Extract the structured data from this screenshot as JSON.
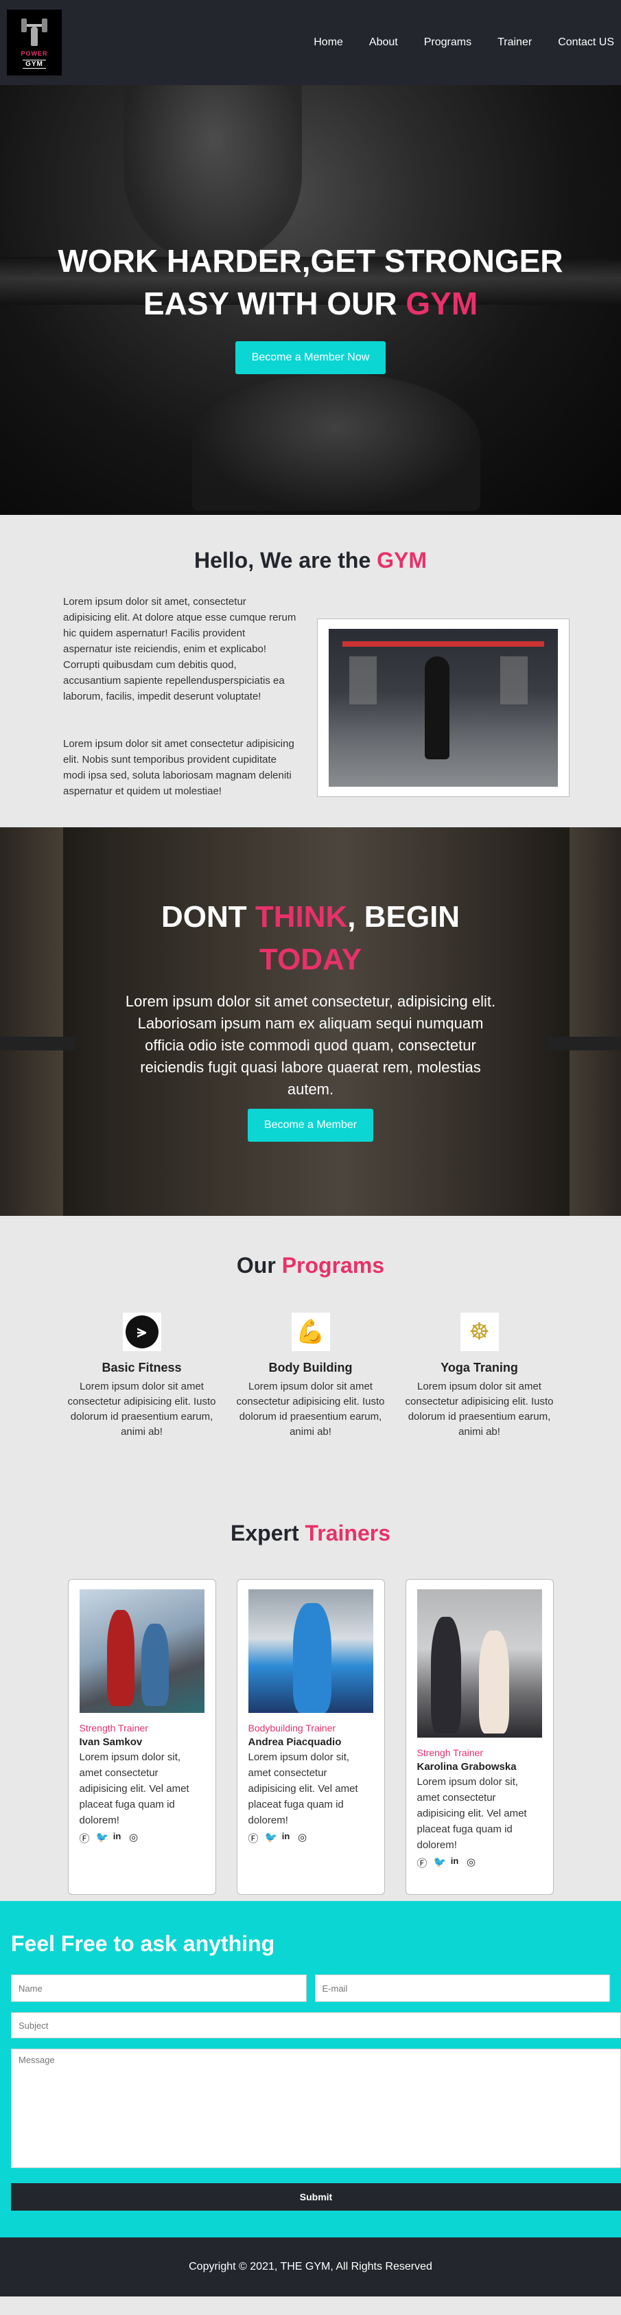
{
  "brand": {
    "logo_line1": "POWER",
    "logo_line2": "GYM"
  },
  "nav": {
    "items": [
      "Home",
      "About",
      "Programs",
      "Trainer",
      "Contact US"
    ]
  },
  "hero": {
    "line1": "WORK HARDER,GET STRONGER",
    "line2_prefix": "EASY WITH OUR ",
    "line2_accent": "GYM",
    "button": "Become a Member Now"
  },
  "about": {
    "title_prefix": "Hello, We are the ",
    "title_accent": "GYM",
    "para1": "Lorem ipsum dolor sit amet, consectetur adipisicing elit. At dolore atque esse cumque rerum hic quidem aspernatur! Facilis provident aspernatur iste reiciendis, enim et explicabo! Corrupti quibusdam cum debitis quod, accusantium sapiente repellendusperspiciatis ea laborum, facilis, impedit deserunt voluptate!",
    "para2": "Lorem ipsum dolor sit amet consectetur adipisicing elit. Nobis sunt temporibus provident cupiditate modi ipsa sed, soluta laboriosam magnam deleniti aspernatur et quidem ut molestiae!"
  },
  "cta": {
    "title_a": "DONT ",
    "title_accent": "THINK",
    "title_b": ", BEGIN",
    "title_accent2": "TODAY",
    "text": "Lorem ipsum dolor sit amet consectetur, adipisicing elit. Laboriosam ipsum nam ex aliquam sequi numquam officia odio iste commodi quod quam, consectetur reiciendis fugit quasi labore quaerat rem, molestias autem.",
    "button": "Become a Member"
  },
  "programs": {
    "title_prefix": "Our ",
    "title_accent": "Programs",
    "items": [
      {
        "name": "Basic Fitness",
        "icon": "dumbbell-icon",
        "desc": "Lorem ipsum dolor sit amet consectetur adipisicing elit. Iusto dolorum id praesentium earum, animi ab!"
      },
      {
        "name": "Body Building",
        "icon": "bodybuilder-icon",
        "desc": "Lorem ipsum dolor sit amet consectetur adipisicing elit. Iusto dolorum id praesentium earum, animi ab!"
      },
      {
        "name": "Yoga Traning",
        "icon": "yoga-icon",
        "desc": "Lorem ipsum dolor sit amet consectetur adipisicing elit. Iusto dolorum id praesentium earum, animi ab!"
      }
    ]
  },
  "trainers": {
    "title_prefix": "Expert ",
    "title_accent": "Trainers",
    "items": [
      {
        "role": "Strength Trainer",
        "name": "Ivan Samkov",
        "desc": "Lorem ipsum dolor sit, amet consectetur adipisicing elit. Vel amet placeat fuga quam id dolorem!"
      },
      {
        "role": "Bodybuilding Trainer",
        "name": "Andrea Piacquadio",
        "desc": "Lorem ipsum dolor sit, amet consectetur adipisicing elit. Vel amet placeat fuga quam id dolorem!"
      },
      {
        "role": "Strengh Trainer",
        "name": "Karolina Grabowska",
        "desc": "Lorem ipsum dolor sit, amet consectetur adipisicing elit. Vel amet placeat fuga quam id dolorem!"
      }
    ],
    "social_icons": [
      "facebook-icon",
      "twitter-icon",
      "linkedin-icon",
      "instagram-icon"
    ]
  },
  "contact": {
    "title": "Feel Free to ask anything",
    "name_placeholder": "Name",
    "email_placeholder": "E-mail",
    "subject_placeholder": "Subject",
    "message_placeholder": "Message",
    "submit": "Submit"
  },
  "footer": {
    "text": "Copyright © 2021, THE GYM, All Rights Reserved"
  },
  "colors": {
    "accent": "#e8316a",
    "cyan": "#0cd6d3",
    "dark": "#23262d"
  }
}
